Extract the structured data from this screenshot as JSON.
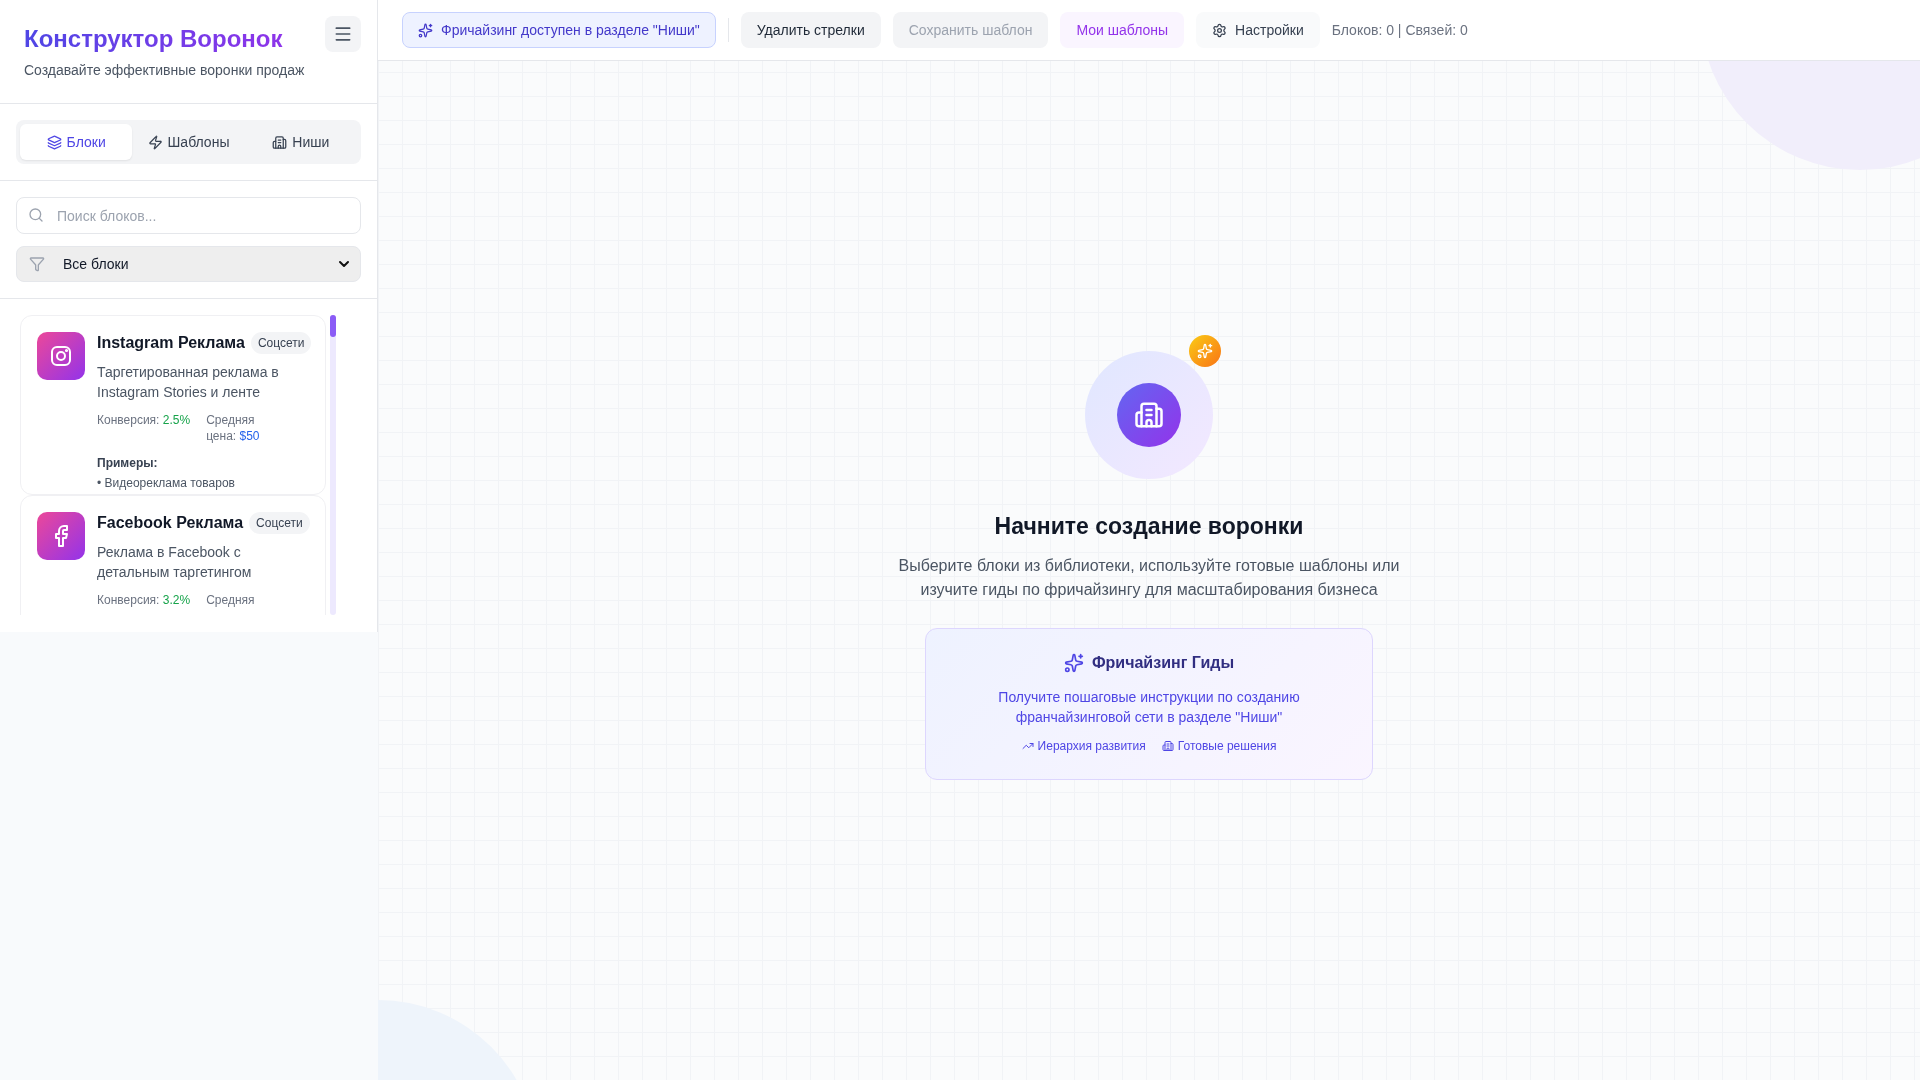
{
  "sidebar": {
    "title": "Конструктор Воронок",
    "subtitle": "Создавайте эффективные воронки продаж",
    "tabs": [
      {
        "label": "Блоки",
        "selected": true
      },
      {
        "label": "Шаблоны",
        "selected": false
      },
      {
        "label": "Ниши",
        "selected": false
      }
    ],
    "search": {
      "placeholder": "Поиск блоков..."
    },
    "filter": {
      "value": "Все блоки"
    },
    "blocks": [
      {
        "kind": "instagram",
        "name": "Instagram Реклама",
        "tag": "Соцсети",
        "description": "Таргетированная реклама в Instagram Stories и ленте",
        "conversion_label": "Конверсия:",
        "conversion": "2.5%",
        "price_label": "Средняя цена:",
        "price": "$50",
        "examples_label": "Примеры:",
        "examples": [
          "• Видеореклама товаров"
        ]
      },
      {
        "kind": "facebook",
        "name": "Facebook Реклама",
        "tag": "Соцсети",
        "description": "Реклама в Facebook с детальным таргетингом",
        "conversion_label": "Конверсия:",
        "conversion": "3.2%",
        "price_label": "Средняя"
      }
    ]
  },
  "toolbar": {
    "buttons": [
      {
        "kind": "notice",
        "label": "Фричайзинг доступен в разделе \"Ниши\"",
        "disabled": false
      },
      {
        "kind": "default",
        "label": "Удалить стрелки",
        "disabled": false
      },
      {
        "kind": "default",
        "label": "Сохранить шаблон",
        "disabled": true
      },
      {
        "kind": "accent",
        "label": "Мои шаблоны",
        "disabled": false
      },
      {
        "kind": "settings",
        "label": "Настройки",
        "disabled": false
      }
    ],
    "stats": "Блоков: 0 | Связей: 0"
  },
  "canvas": {
    "title": "Начните создание воронки",
    "description": "Выберите блоки из библиотеки, используйте готовые шаблоны или изучите гиды по фричайзингу для масштабирования бизнеса",
    "guide": {
      "title": "Фричайзинг Гиды",
      "text": "Получите пошаговые инструкции по созданию франчайзинговой сети в разделе \"Ниши\"",
      "links": [
        {
          "kind": "trend",
          "label": "Иерархия развития"
        },
        {
          "kind": "building",
          "label": "Готовые решения"
        }
      ]
    }
  }
}
